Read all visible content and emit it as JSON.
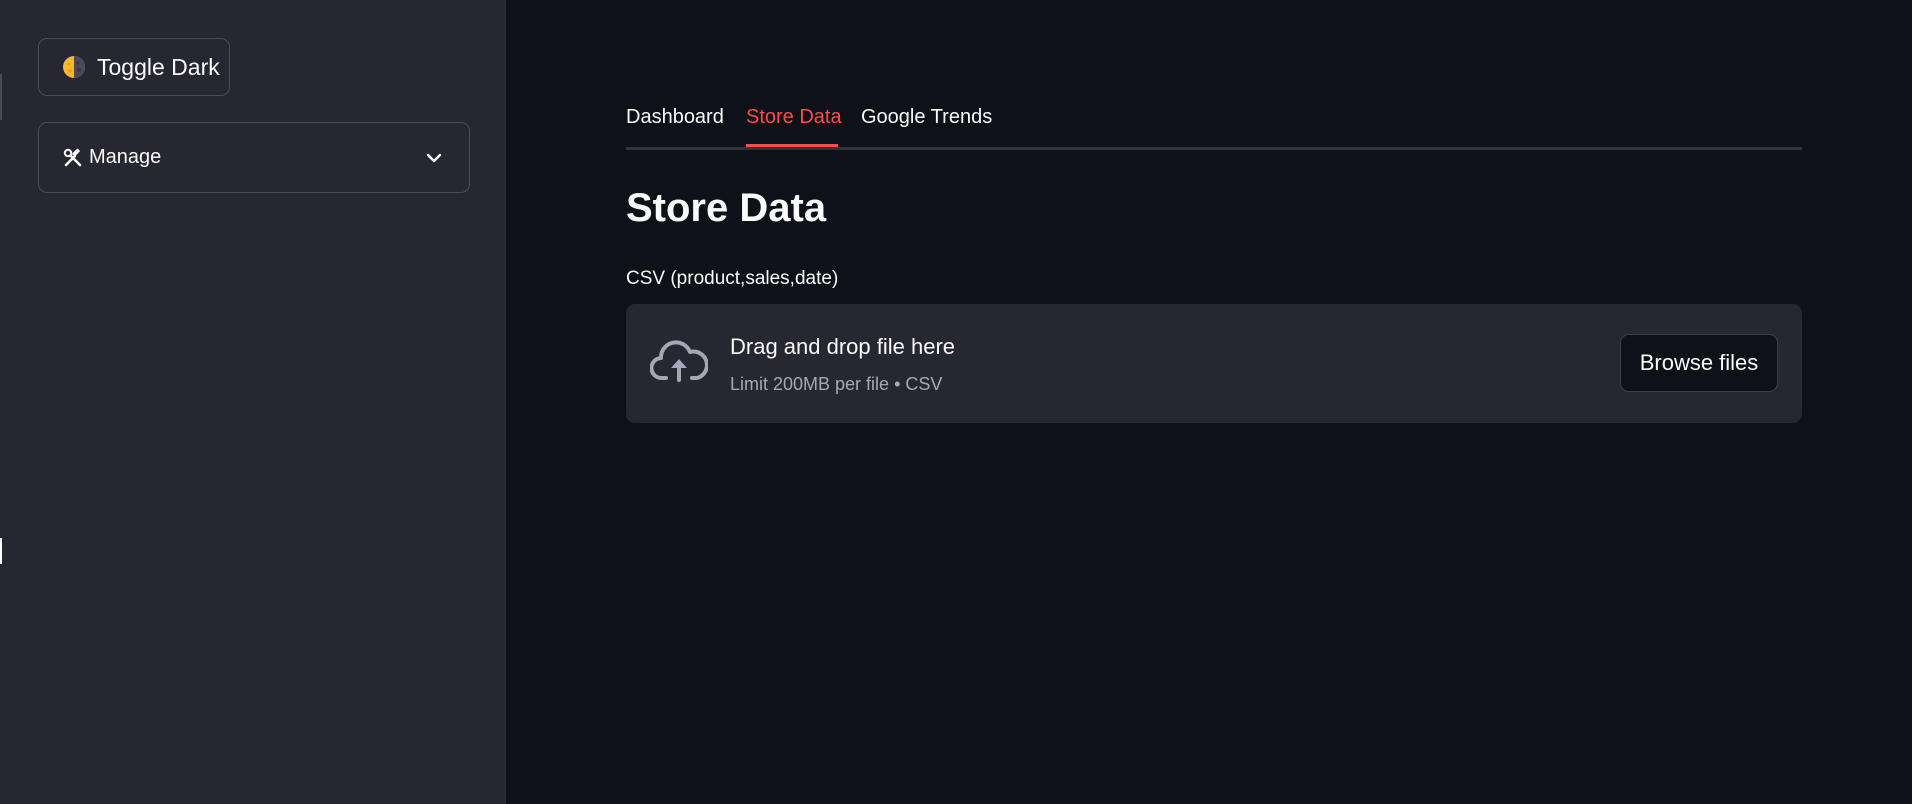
{
  "sidebar": {
    "theme_toggle": {
      "label": "Toggle Dark",
      "icon": "half-moon-icon"
    },
    "expander": {
      "icon": "hammer-wrench-icon",
      "label": "Manage",
      "chevron": "chevron-down-icon"
    }
  },
  "main": {
    "tabs": [
      {
        "label": "Dashboard",
        "active": false
      },
      {
        "label": "Store Data",
        "active": true
      },
      {
        "label": "Google Trends",
        "active": false
      }
    ],
    "title": "Store Data",
    "uploader": {
      "label": "CSV (product,sales,date)",
      "icon": "cloud-upload-icon",
      "drop_text": "Drag and drop file here",
      "limit_text": "Limit 200MB per file • CSV",
      "browse_label": "Browse files"
    }
  },
  "colors": {
    "background": "#0e1117",
    "sidebar": "#262730",
    "accent": "#ff4b4b",
    "text": "#fafafa",
    "muted_text": "#a3a8b8"
  }
}
